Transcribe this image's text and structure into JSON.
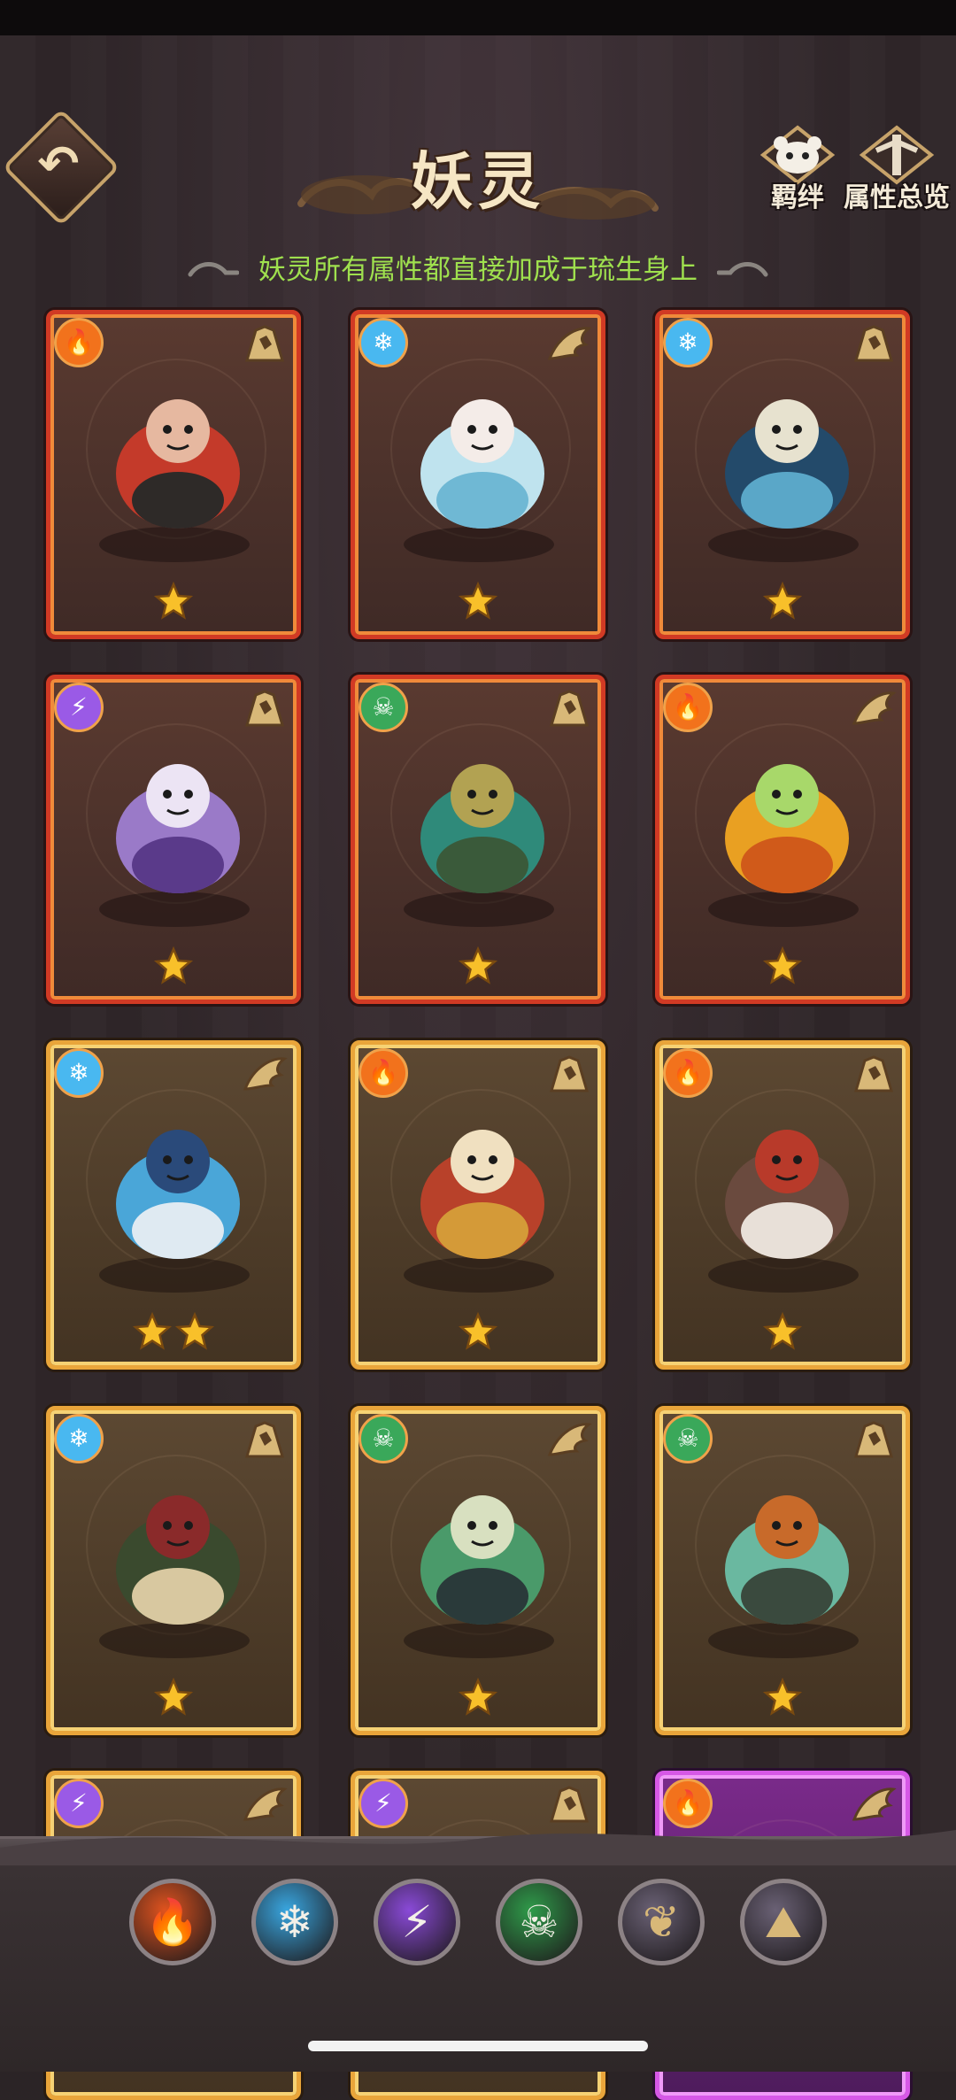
{
  "header": {
    "title": "妖灵",
    "subtitle": "妖灵所有属性都直接加成于琉生身上",
    "bond_label": "羁绊",
    "overview_label": "属性总览"
  },
  "cards": [
    {
      "frame": "red",
      "element": "fire",
      "type": "shell",
      "creature": "red-haired-ape",
      "stars": 1
    },
    {
      "frame": "red",
      "element": "ice",
      "type": "wing",
      "creature": "snow-girl",
      "stars": 1
    },
    {
      "frame": "red",
      "element": "ice",
      "type": "shell",
      "creature": "penguin-scholar",
      "stars": 1
    },
    {
      "frame": "red",
      "element": "thunder",
      "type": "shell",
      "creature": "purple-cat",
      "stars": 1
    },
    {
      "frame": "red",
      "element": "poison",
      "type": "shell",
      "creature": "serpent-tortoise",
      "stars": 1
    },
    {
      "frame": "red",
      "element": "fire",
      "type": "wing",
      "creature": "phoenix",
      "stars": 1
    },
    {
      "frame": "gold",
      "element": "ice",
      "type": "wing",
      "creature": "koi-fish",
      "stars": 2
    },
    {
      "frame": "gold",
      "element": "fire",
      "type": "shell",
      "creature": "shield-boar",
      "stars": 1
    },
    {
      "frame": "gold",
      "element": "fire",
      "type": "shell",
      "creature": "hat-kappa",
      "stars": 1
    },
    {
      "frame": "gold",
      "element": "ice",
      "type": "shell",
      "creature": "crab-lantern",
      "stars": 1
    },
    {
      "frame": "gold",
      "element": "poison",
      "type": "wing",
      "creature": "bird-mantis",
      "stars": 1
    },
    {
      "frame": "gold",
      "element": "poison",
      "type": "shell",
      "creature": "ram-deer",
      "stars": 1
    },
    {
      "frame": "gold",
      "element": "thunder",
      "type": "wing",
      "creature": "unknown",
      "stars": 0
    },
    {
      "frame": "gold",
      "element": "thunder",
      "type": "shell",
      "creature": "unknown",
      "stars": 0
    },
    {
      "frame": "purple",
      "element": "fire",
      "type": "wing",
      "creature": "unknown",
      "stars": 0
    }
  ],
  "filters": [
    {
      "name": "fire-filter",
      "glyph": "🔥",
      "color": "#e0531e"
    },
    {
      "name": "ice-filter",
      "glyph": "❄",
      "color": "#39a6e0"
    },
    {
      "name": "thunder-filter",
      "glyph": "⚡",
      "color": "#8a4ad8"
    },
    {
      "name": "poison-filter",
      "glyph": "☠",
      "color": "#2f9b4a"
    },
    {
      "name": "wing-filter",
      "glyph": "❦",
      "color": "#6a6175"
    },
    {
      "name": "shell-filter",
      "glyph": "⛰",
      "color": "#6a6175"
    }
  ],
  "colors": {
    "fire": "#f2721c",
    "ice": "#49b8f0",
    "thunder": "#9a5ae6",
    "poison": "#3aa85a",
    "subtitle": "#9fe04e",
    "star": "#f8c02a"
  }
}
